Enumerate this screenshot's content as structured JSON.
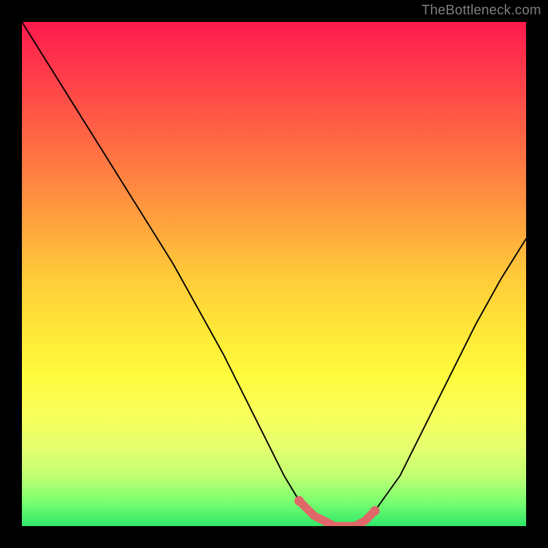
{
  "attribution": "TheBottleneck.com",
  "colors": {
    "frame": "#000000",
    "curve": "#000000",
    "marker": "#e06868",
    "gradient_top": "#ff1a4d",
    "gradient_bottom": "#30e86a"
  },
  "chart_data": {
    "type": "line",
    "title": "",
    "xlabel": "",
    "ylabel": "",
    "xlim": [
      0,
      100
    ],
    "ylim": [
      0,
      100
    ],
    "annotations": [],
    "series": [
      {
        "name": "bottleneck-curve",
        "x": [
          0,
          5,
          10,
          15,
          20,
          25,
          30,
          35,
          40,
          45,
          50,
          52,
          55,
          58,
          60,
          62,
          64,
          66,
          68,
          70,
          75,
          80,
          85,
          90,
          95,
          100
        ],
        "values": [
          100,
          92,
          84,
          76,
          68,
          60,
          52,
          43,
          34,
          24,
          14,
          10,
          5,
          2,
          1,
          0,
          0,
          0,
          1,
          3,
          10,
          20,
          30,
          40,
          49,
          57
        ]
      }
    ],
    "markers": {
      "name": "optimal-range",
      "x": [
        55,
        58,
        60,
        62,
        64,
        66,
        68,
        70
      ],
      "values": [
        5,
        2,
        1,
        0,
        0,
        0,
        1,
        3
      ]
    }
  }
}
